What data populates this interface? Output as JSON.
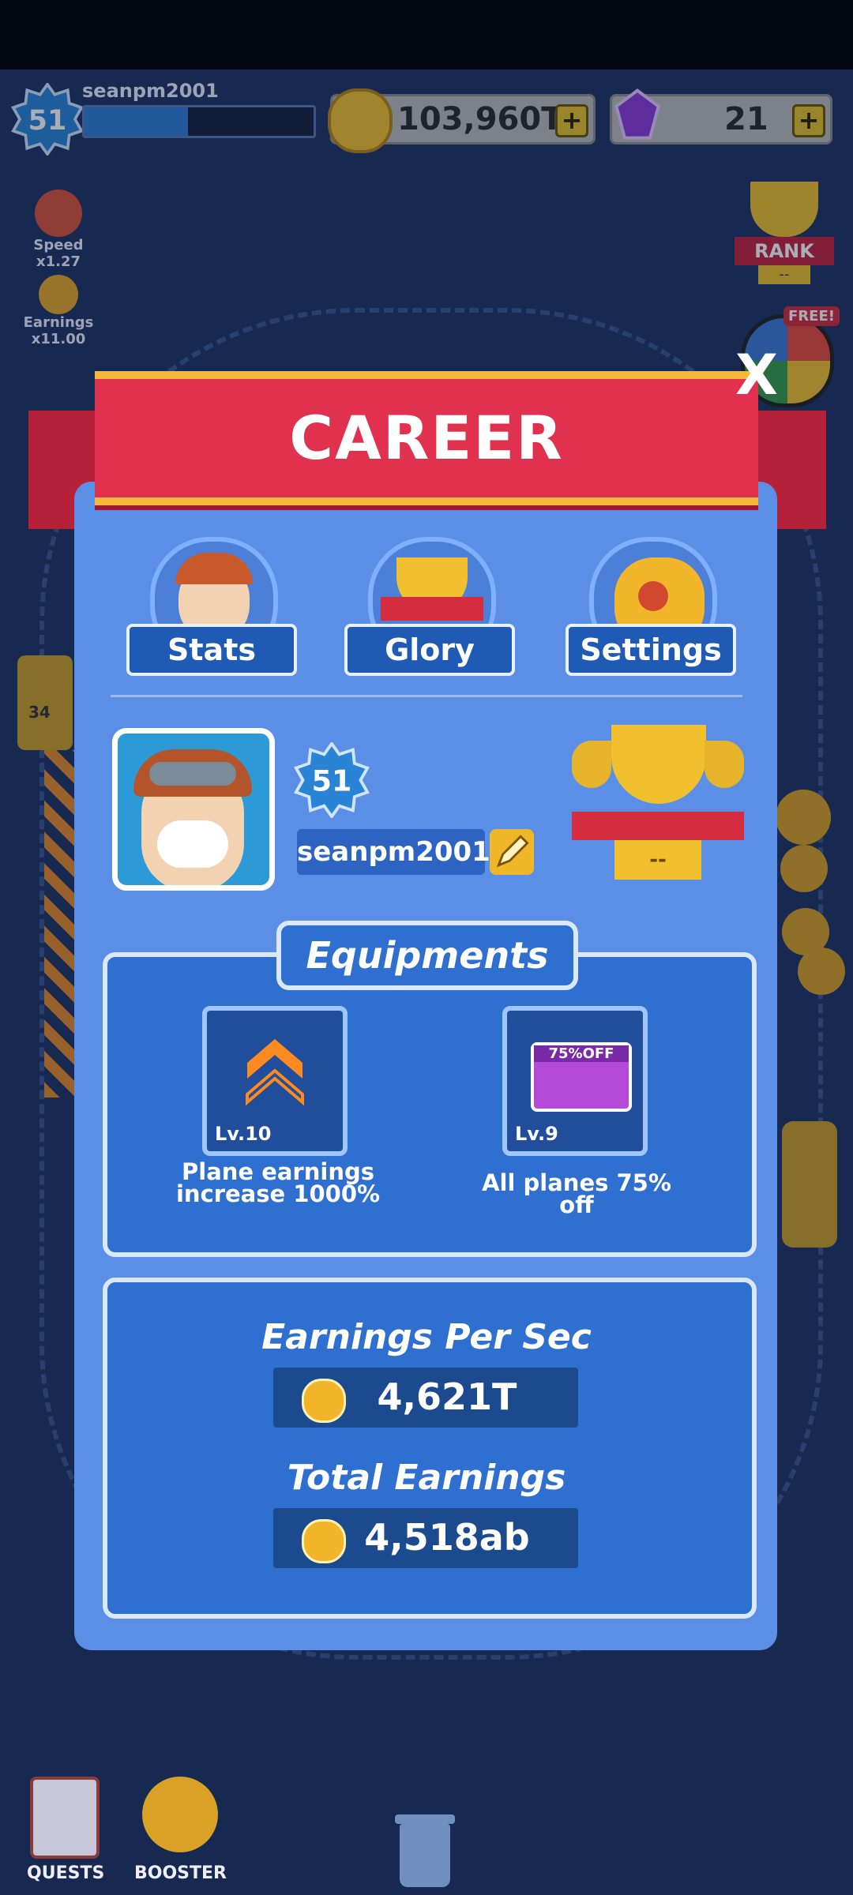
{
  "hud": {
    "level": "51",
    "username": "seanpm2001",
    "xp_progress": 0.45,
    "coins": "103,960T",
    "gems": "21",
    "plus_label": "+"
  },
  "side_left": {
    "speed_label": "Speed x1.27",
    "earnings_label": "Earnings x11.00"
  },
  "side_right": {
    "rank_label": "RANK",
    "rank_value": "--",
    "spin_free_label": "FREE!",
    "spin_label": "SPIN"
  },
  "modal": {
    "title": "CAREER",
    "close_label": "X",
    "tabs": [
      {
        "label": "Stats"
      },
      {
        "label": "Glory"
      },
      {
        "label": "Settings"
      }
    ],
    "profile": {
      "level": "51",
      "name": "seanpm2001",
      "trophy_value": "--"
    },
    "equipments": {
      "title": "Equipments",
      "items": [
        {
          "level": "Lv.10",
          "description": "Plane earnings increase 1000%"
        },
        {
          "level": "Lv.9",
          "badge": "75%OFF",
          "description": "All planes 75% off"
        }
      ]
    },
    "earnings": {
      "per_sec_label": "Earnings Per Sec",
      "per_sec_value": "4,621T",
      "total_label": "Total Earnings",
      "total_value": "4,518ab"
    }
  },
  "bottom_bar": {
    "quests_label": "QUESTS",
    "booster_label": "BOOSTER"
  },
  "track_number": "34"
}
